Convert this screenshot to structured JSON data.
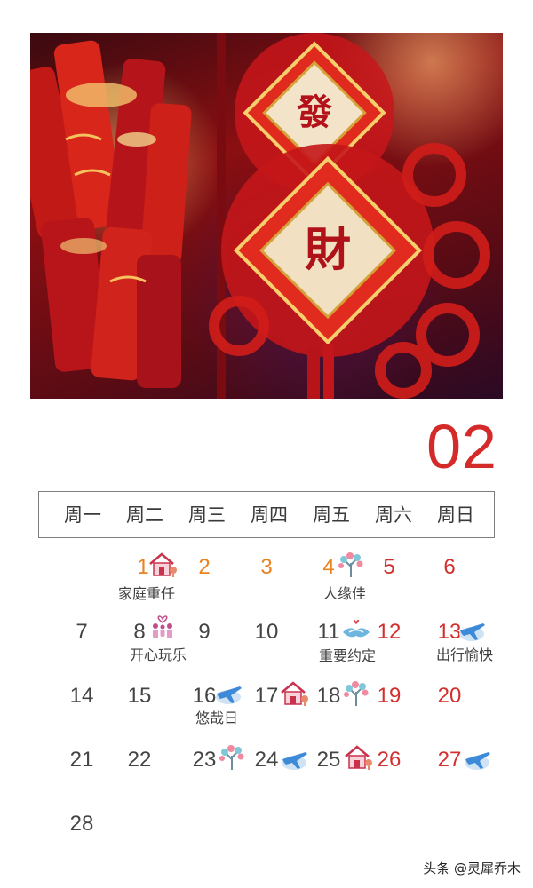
{
  "photo": {
    "sign_top": "發",
    "sign_bottom": "財"
  },
  "month": "02",
  "weekdays": [
    "周一",
    "周二",
    "周三",
    "周四",
    "周五",
    "周六",
    "周日"
  ],
  "days": [
    {
      "day": "1",
      "color": "orange",
      "icon": "house-icon"
    },
    {
      "day": "2",
      "color": "orange",
      "icon": ""
    },
    {
      "day": "3",
      "color": "orange",
      "icon": ""
    },
    {
      "day": "4",
      "color": "orange",
      "icon": "tree-icon"
    },
    {
      "day": "5",
      "color": "red",
      "icon": ""
    },
    {
      "day": "6",
      "color": "red",
      "icon": ""
    },
    {
      "day": "7",
      "color": "dark",
      "icon": ""
    },
    {
      "day": "8",
      "color": "dark",
      "icon": "family-icon"
    },
    {
      "day": "9",
      "color": "dark",
      "icon": ""
    },
    {
      "day": "10",
      "color": "dark",
      "icon": ""
    },
    {
      "day": "11",
      "color": "dark",
      "icon": "handshake-icon"
    },
    {
      "day": "12",
      "color": "red",
      "icon": ""
    },
    {
      "day": "13",
      "color": "red",
      "icon": "airplane-icon"
    },
    {
      "day": "14",
      "color": "dark",
      "icon": ""
    },
    {
      "day": "15",
      "color": "dark",
      "icon": ""
    },
    {
      "day": "16",
      "color": "dark",
      "icon": "airplane-icon"
    },
    {
      "day": "17",
      "color": "dark",
      "icon": "house-icon"
    },
    {
      "day": "18",
      "color": "dark",
      "icon": "tree-icon"
    },
    {
      "day": "19",
      "color": "red",
      "icon": ""
    },
    {
      "day": "20",
      "color": "red",
      "icon": ""
    },
    {
      "day": "21",
      "color": "dark",
      "icon": ""
    },
    {
      "day": "22",
      "color": "dark",
      "icon": ""
    },
    {
      "day": "23",
      "color": "dark",
      "icon": "tree-icon"
    },
    {
      "day": "24",
      "color": "dark",
      "icon": "airplane-icon"
    },
    {
      "day": "25",
      "color": "dark",
      "icon": "house-icon"
    },
    {
      "day": "26",
      "color": "red",
      "icon": ""
    },
    {
      "day": "27",
      "color": "red",
      "icon": "airplane-icon"
    },
    {
      "day": "28",
      "color": "dark",
      "icon": ""
    }
  ],
  "notes": {
    "d1": "家庭重任",
    "d4": "人缘佳",
    "d8": "开心玩乐",
    "d11": "重要约定",
    "d13": "出行愉快",
    "d16": "悠哉日"
  },
  "colors": {
    "dark": "#444444",
    "orange": "#e9821f",
    "red": "#d2302f",
    "month": "#d42a2a",
    "border": "#7d7d7d"
  },
  "watermark": "头条 @灵犀乔木"
}
